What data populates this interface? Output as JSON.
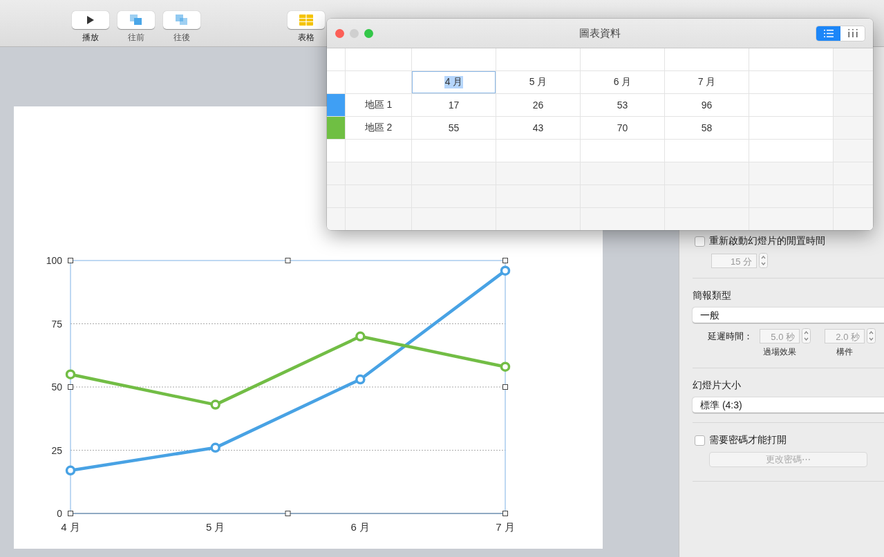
{
  "toolbar": {
    "buttons": [
      {
        "label": "播放",
        "kind": "play"
      },
      {
        "label": "往前",
        "kind": "forward"
      },
      {
        "label": "往後",
        "kind": "backward"
      },
      {
        "label": "表格",
        "kind": "table"
      }
    ]
  },
  "slide": {
    "chart_selected": true,
    "chart_data": {
      "type": "line",
      "grid": true,
      "categories": [
        "4 月",
        "5 月",
        "6 月",
        "7 月"
      ],
      "ylim": [
        0,
        100
      ],
      "yticks": [
        0,
        25,
        50,
        75,
        100
      ],
      "series": [
        {
          "color": "#48a2e4",
          "marker": true,
          "values": [
            17,
            26,
            53,
            96
          ]
        },
        {
          "color": "#72bd45",
          "marker": true,
          "values": [
            55,
            43,
            70,
            58
          ]
        }
      ]
    }
  },
  "inspector": {
    "idle_restart": {
      "label": "重新啟動幻燈片的閒置時間",
      "checked": false,
      "value": "15 分",
      "disabled": true
    },
    "presentation_type": {
      "heading": "簡報類型",
      "value": "一般",
      "delay_label": "延遲時間：",
      "delays": [
        {
          "value": "5.0 秒",
          "caption": "過場效果",
          "disabled": true
        },
        {
          "value": "2.0 秒",
          "caption": "構件",
          "disabled": true
        }
      ]
    },
    "slide_size": {
      "heading": "幻燈片大小",
      "value": "標準 (4:3)"
    },
    "password": {
      "label": "需要密碼才能打開",
      "checked": false,
      "button": "更改密碼⋯",
      "button_disabled": true
    }
  },
  "chart_data_window": {
    "title": "圖表資料",
    "view_modes": [
      {
        "kind": "rows",
        "selected": true
      },
      {
        "kind": "columns",
        "selected": false
      }
    ],
    "columns": [
      {
        "label": "4 月",
        "selected": true
      },
      {
        "label": "5 月",
        "selected": false
      },
      {
        "label": "6 月",
        "selected": false
      },
      {
        "label": "7 月",
        "selected": false
      }
    ],
    "rows": [
      {
        "label": "地區 1",
        "color": "#3f9ff4",
        "values": [
          "17",
          "26",
          "53",
          "96"
        ]
      },
      {
        "label": "地區 2",
        "color": "#6fbf43",
        "values": [
          "55",
          "43",
          "70",
          "58"
        ]
      }
    ]
  }
}
